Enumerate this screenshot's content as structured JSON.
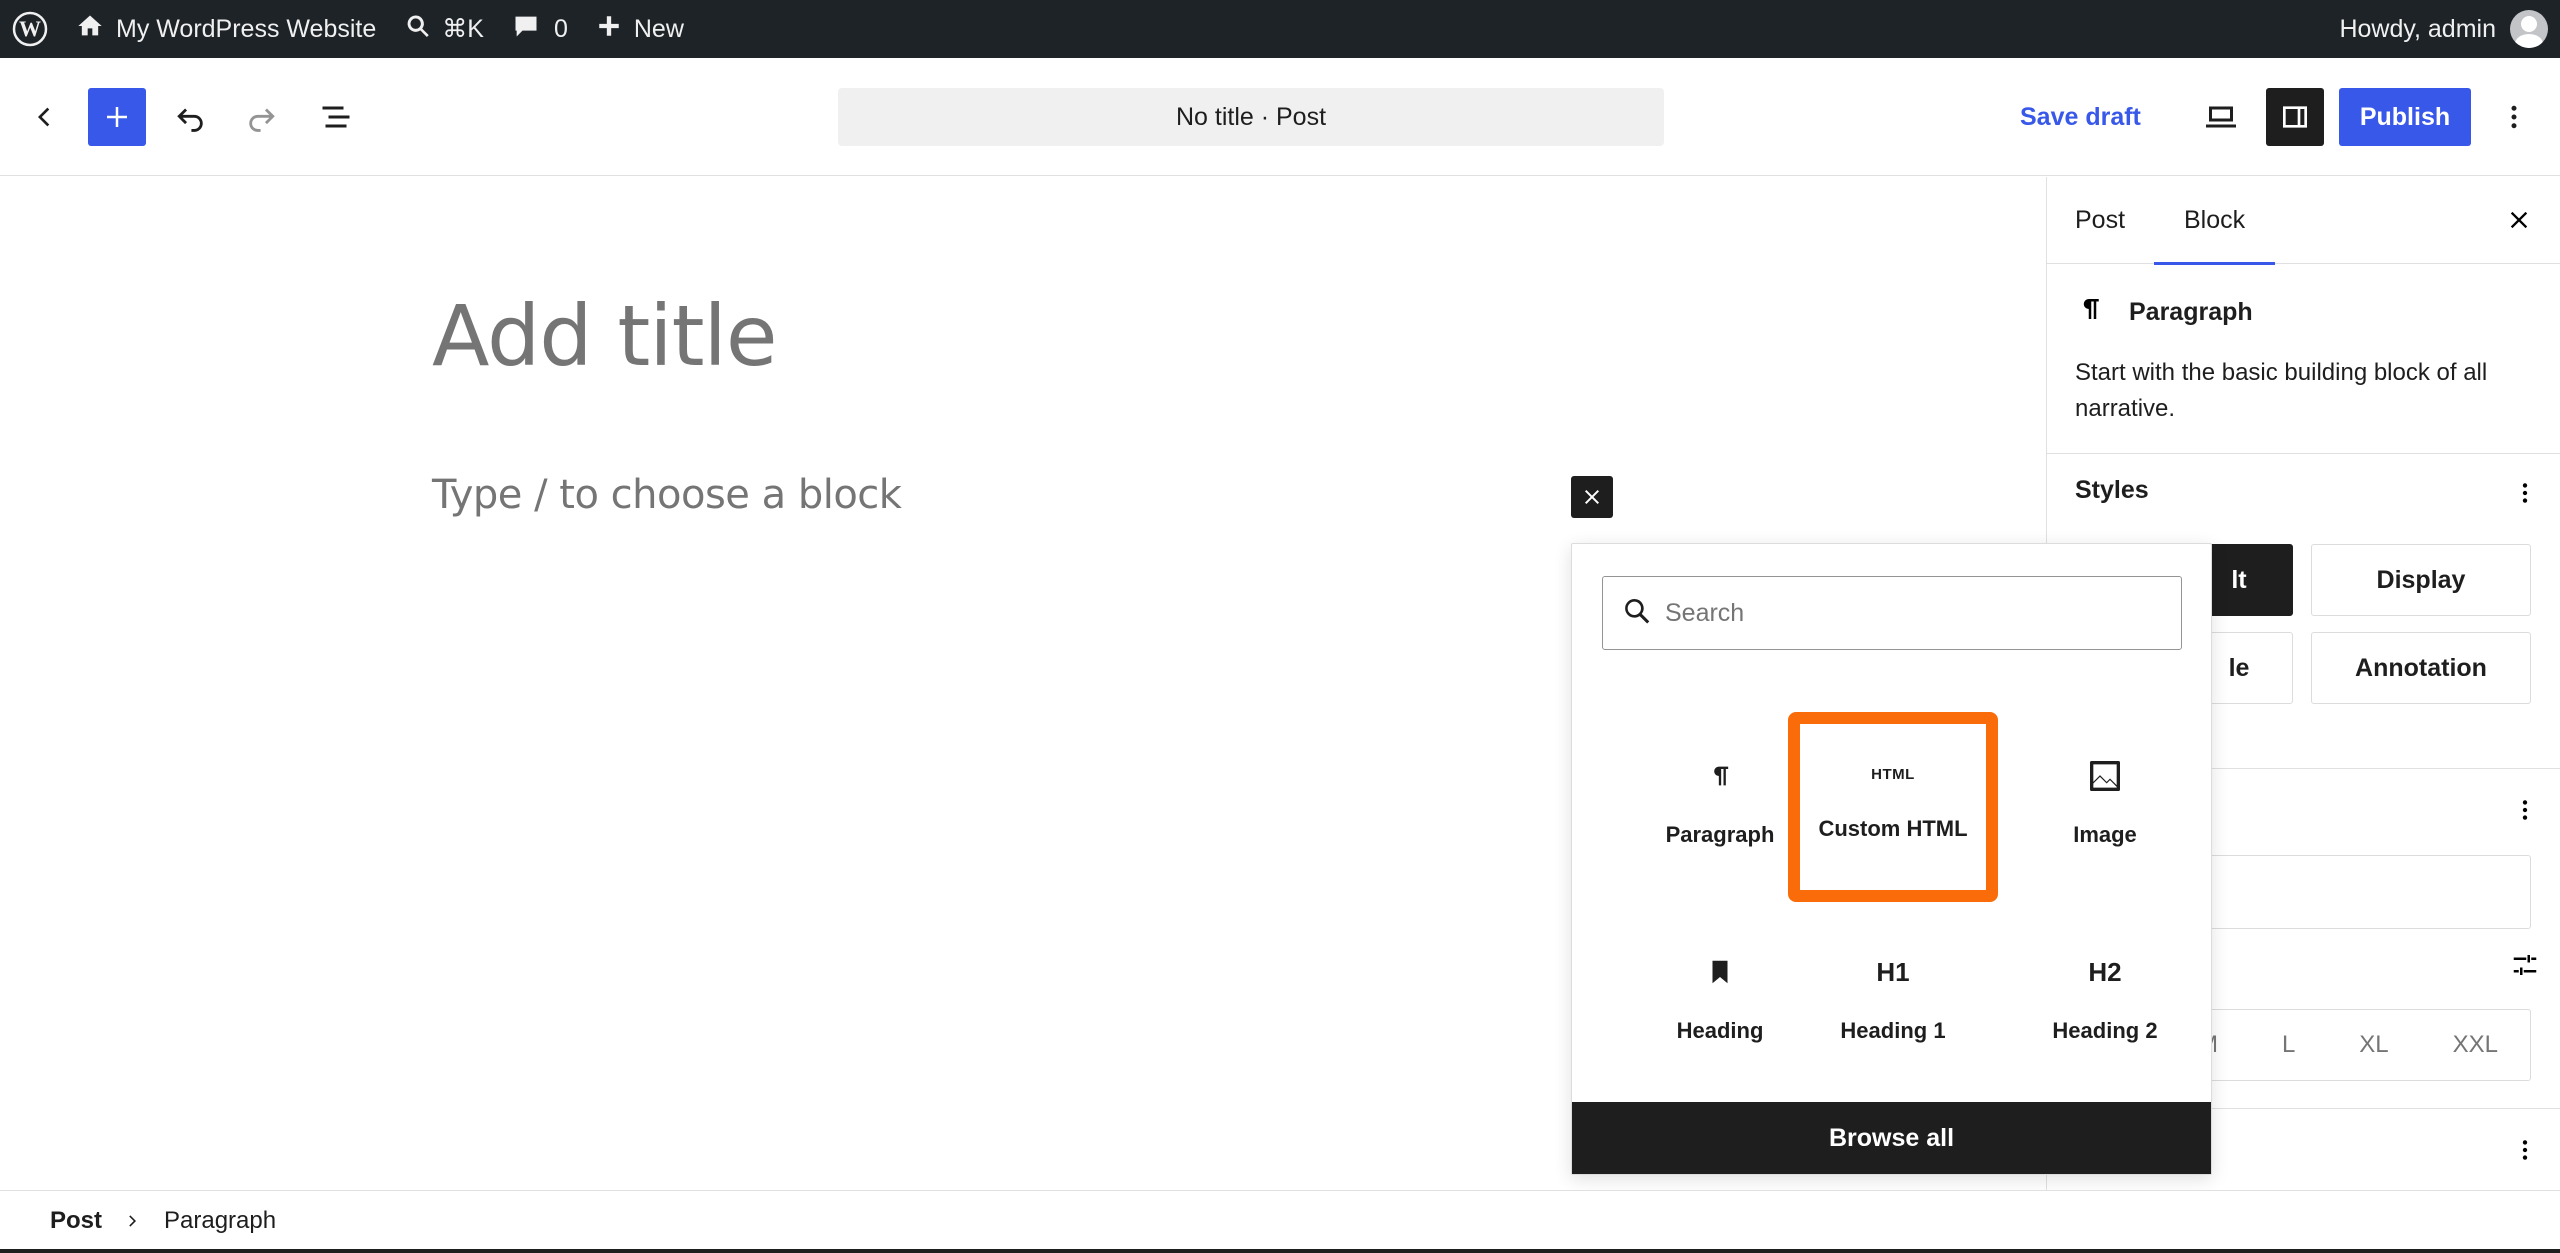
{
  "adminbar": {
    "site_name": "My WordPress Website",
    "search_shortcut": "⌘K",
    "comments_count": "0",
    "new_label": "New",
    "howdy": "Howdy, admin"
  },
  "header": {
    "document_title": "No title · Post",
    "save_draft": "Save draft",
    "publish": "Publish"
  },
  "canvas": {
    "title_placeholder": "Add title",
    "block_placeholder": "Type / to choose a block"
  },
  "sidebar": {
    "tabs": [
      {
        "label": "Post"
      },
      {
        "label": "Block"
      }
    ],
    "block": {
      "name": "Paragraph",
      "description": "Start with the basic building block of all narrative."
    },
    "styles": {
      "title": "Styles",
      "options": [
        "lt",
        "Display",
        "le",
        "Annotation"
      ]
    },
    "typography": {
      "partial_label": "·",
      "sizes": [
        "M",
        "L",
        "XL",
        "XXL"
      ]
    }
  },
  "inserter": {
    "search_placeholder": "Search",
    "blocks": [
      {
        "label": "Paragraph",
        "icon": "paragraph-icon"
      },
      {
        "label": "Custom HTML",
        "icon": "html-icon",
        "icon_text": "HTML",
        "highlighted": true
      },
      {
        "label": "Image",
        "icon": "image-icon"
      },
      {
        "label": "Heading",
        "icon": "bookmark-icon"
      },
      {
        "label": "Heading 1",
        "icon": "heading-1-icon",
        "icon_text": "H1"
      },
      {
        "label": "Heading 2",
        "icon": "heading-2-icon",
        "icon_text": "H2"
      }
    ],
    "browse_all": "Browse all"
  },
  "footer": {
    "breadcrumb": [
      "Post",
      "Paragraph"
    ]
  },
  "colors": {
    "admin_bar": "#1d2327",
    "accent": "#3858e9",
    "highlight": "#f96c09",
    "dark": "#1e1e1e"
  }
}
